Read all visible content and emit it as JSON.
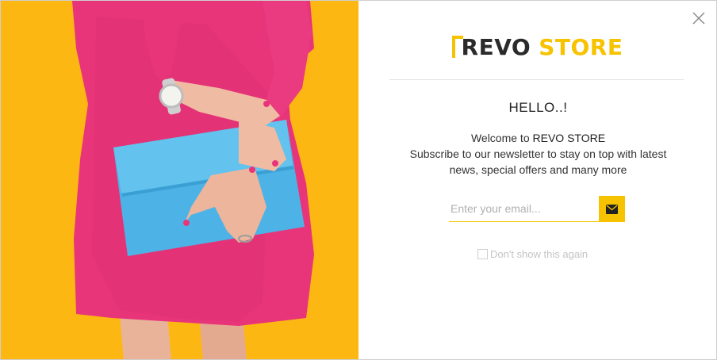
{
  "logo": {
    "part1": "REVO",
    "part2": "STORE",
    "mark_icon": "logo-bracket-icon"
  },
  "close": {
    "icon": "close-icon"
  },
  "heading": "HELLO..!",
  "welcome": {
    "line1_prefix": "Welcome to ",
    "line1_brand": "REVO STORE",
    "line2": "Subscribe to our newsletter to stay on top with latest",
    "line3": "news, special offers and many more"
  },
  "form": {
    "email_placeholder": "Enter your email...",
    "email_value": "",
    "submit_icon": "envelope-icon"
  },
  "dont_show": {
    "label": "Don't show this again",
    "checked": false
  },
  "colors": {
    "accent": "#f7c300",
    "image_background": "#fdb713",
    "dress": "#e8357a",
    "clutch": "#4db3e6"
  }
}
